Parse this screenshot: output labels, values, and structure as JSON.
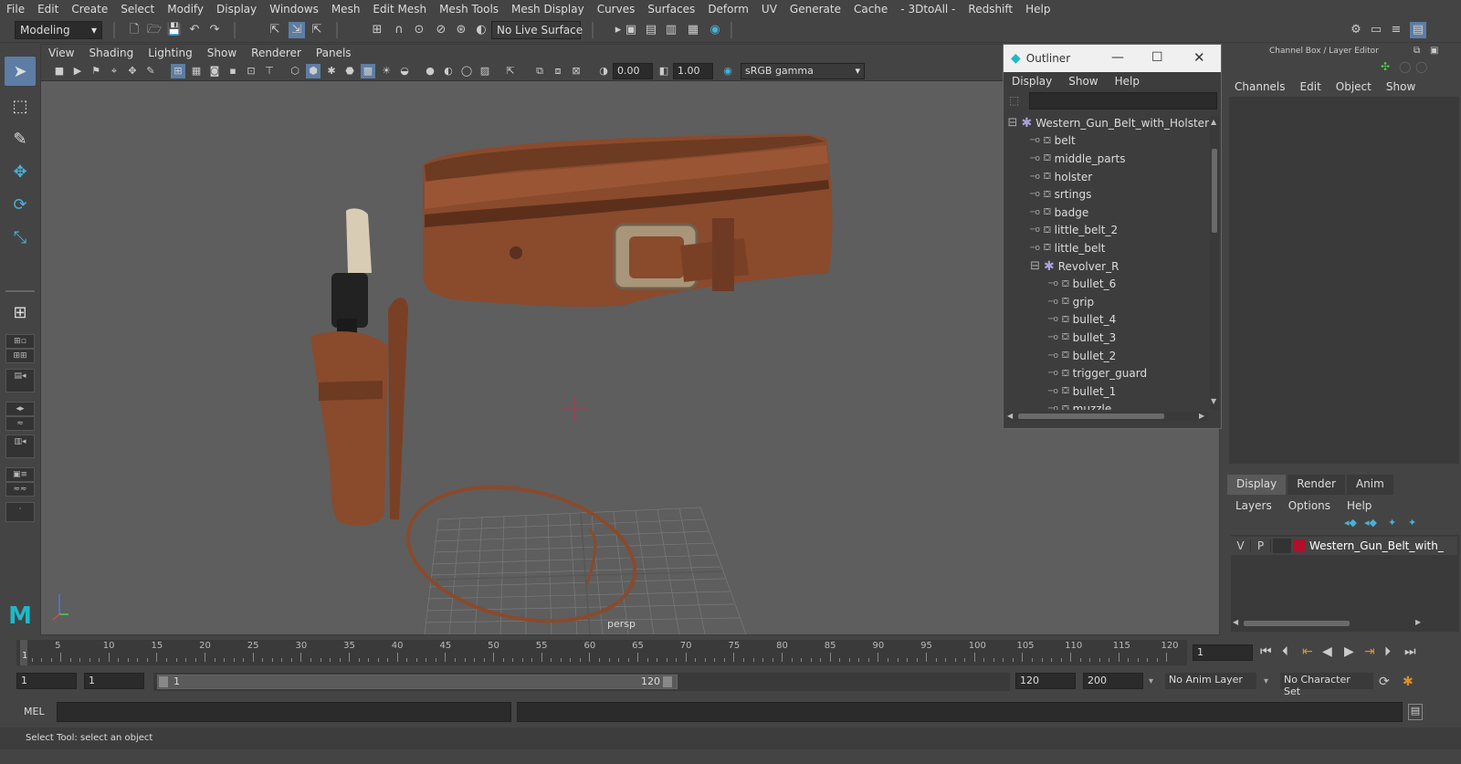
{
  "menu": [
    "File",
    "Edit",
    "Create",
    "Select",
    "Modify",
    "Display",
    "Windows",
    "Mesh",
    "Edit Mesh",
    "Mesh Tools",
    "Mesh Display",
    "Curves",
    "Surfaces",
    "Deform",
    "UV",
    "Generate",
    "Cache",
    "- 3DtoAll -",
    "Redshift",
    "Help"
  ],
  "shelf": {
    "mode": "Modeling",
    "live_surface": "No Live Surface"
  },
  "viewport": {
    "menu": [
      "View",
      "Shading",
      "Lighting",
      "Show",
      "Renderer",
      "Panels"
    ],
    "exposure": "0.00",
    "gamma": "1.00",
    "color_space": "sRGB gamma",
    "camera_label": "persp"
  },
  "outliner": {
    "title": "Outliner",
    "menu": [
      "Display",
      "Show",
      "Help"
    ],
    "items": [
      {
        "label": "Western_Gun_Belt_with_Holster",
        "depth": 0,
        "type": "group",
        "expanded": true
      },
      {
        "label": "belt",
        "depth": 1,
        "type": "mesh"
      },
      {
        "label": "middle_parts",
        "depth": 1,
        "type": "mesh"
      },
      {
        "label": "holster",
        "depth": 1,
        "type": "mesh"
      },
      {
        "label": "srtings",
        "depth": 1,
        "type": "mesh"
      },
      {
        "label": "badge",
        "depth": 1,
        "type": "mesh"
      },
      {
        "label": "little_belt_2",
        "depth": 1,
        "type": "mesh"
      },
      {
        "label": "little_belt",
        "depth": 1,
        "type": "mesh"
      },
      {
        "label": "Revolver_R",
        "depth": 1,
        "type": "group",
        "expanded": true
      },
      {
        "label": "bullet_6",
        "depth": 2,
        "type": "mesh"
      },
      {
        "label": "grip",
        "depth": 2,
        "type": "mesh"
      },
      {
        "label": "bullet_4",
        "depth": 2,
        "type": "mesh"
      },
      {
        "label": "bullet_3",
        "depth": 2,
        "type": "mesh"
      },
      {
        "label": "bullet_2",
        "depth": 2,
        "type": "mesh"
      },
      {
        "label": "trigger_guard",
        "depth": 2,
        "type": "mesh"
      },
      {
        "label": "bullet_1",
        "depth": 2,
        "type": "mesh"
      },
      {
        "label": "muzzle",
        "depth": 2,
        "type": "mesh"
      }
    ]
  },
  "channel_box": {
    "title": "Channel Box / Layer Editor",
    "menu": [
      "Channels",
      "Edit",
      "Object",
      "Show"
    ],
    "tabs": [
      "Display",
      "Render",
      "Anim"
    ],
    "layer_menu": [
      "Layers",
      "Options",
      "Help"
    ],
    "layer": {
      "v": "V",
      "p": "P",
      "name": "Western_Gun_Belt_with_",
      "color": "#b0102a"
    }
  },
  "timeline": {
    "ticks": [
      "5",
      "10",
      "15",
      "20",
      "25",
      "30",
      "35",
      "40",
      "45",
      "50",
      "55",
      "60",
      "65",
      "70",
      "75",
      "80",
      "85",
      "90",
      "95",
      "100",
      "105",
      "110",
      "115",
      "120"
    ],
    "start_mark": "1",
    "current_frame": "1"
  },
  "range": {
    "start": "1",
    "playback_start": "1",
    "slider_start": "1",
    "slider_end": "120",
    "playback_end": "120",
    "end": "200",
    "anim_layer": "No Anim Layer",
    "character_set": "No Character Set"
  },
  "command": {
    "label": "MEL"
  },
  "help_line": "Select Tool: select an object",
  "colors": {
    "accent": "#5d7da4",
    "viewport_bg": "#5e5e5e",
    "leather": "#8a4a2c"
  }
}
